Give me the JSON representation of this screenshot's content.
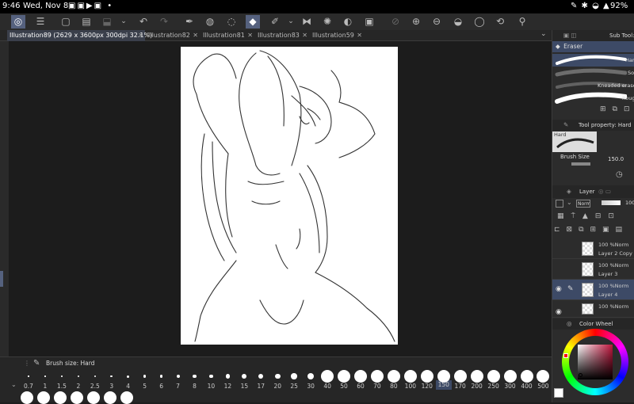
{
  "status": {
    "time": "9:46",
    "date": "Wed, Nov 8",
    "battery": "92%"
  },
  "tabs": [
    {
      "label": "Illustration89 (2629 x 3600px 300dpi 32.1%)",
      "active": true
    },
    {
      "label": "Illustration82",
      "active": false
    },
    {
      "label": "Illustration81",
      "active": false
    },
    {
      "label": "Illustration83",
      "active": false
    },
    {
      "label": "Illustration59",
      "active": false
    }
  ],
  "brush_panel": {
    "title": "Brush size: Hard",
    "sizes": [
      "0.7",
      "1",
      "1.5",
      "2",
      "2.5",
      "3",
      "4",
      "5",
      "6",
      "7",
      "8",
      "10",
      "12",
      "15",
      "17",
      "20",
      "25",
      "30",
      "40",
      "50",
      "60",
      "70",
      "80",
      "100",
      "120",
      "150",
      "170",
      "200",
      "250",
      "300",
      "400",
      "500"
    ],
    "selected": "150"
  },
  "sub_tool": {
    "title": "Sub Tool:",
    "group": "Eraser",
    "items": [
      "Hard",
      "Soft",
      "Kneaded eraser",
      "Rough"
    ]
  },
  "tool_property": {
    "title": "Tool property: Hard",
    "preset": "Hard",
    "brush_size_label": "Brush Size",
    "brush_size_value": "150.0"
  },
  "layer_panel": {
    "title": "Layer",
    "blend_mode": "Norm",
    "opacity": "100",
    "layers": [
      {
        "meta": "100 %Norm",
        "name": "Layer 2 Copy"
      },
      {
        "meta": "100 %Norm",
        "name": "Layer 3"
      },
      {
        "meta": "100 %Norm",
        "name": "Layer 4",
        "selected": true
      },
      {
        "meta": "100 %Norm",
        "name": ""
      }
    ]
  },
  "color_wheel": {
    "title": "Color Wheel",
    "main_color": "#ffffff"
  }
}
